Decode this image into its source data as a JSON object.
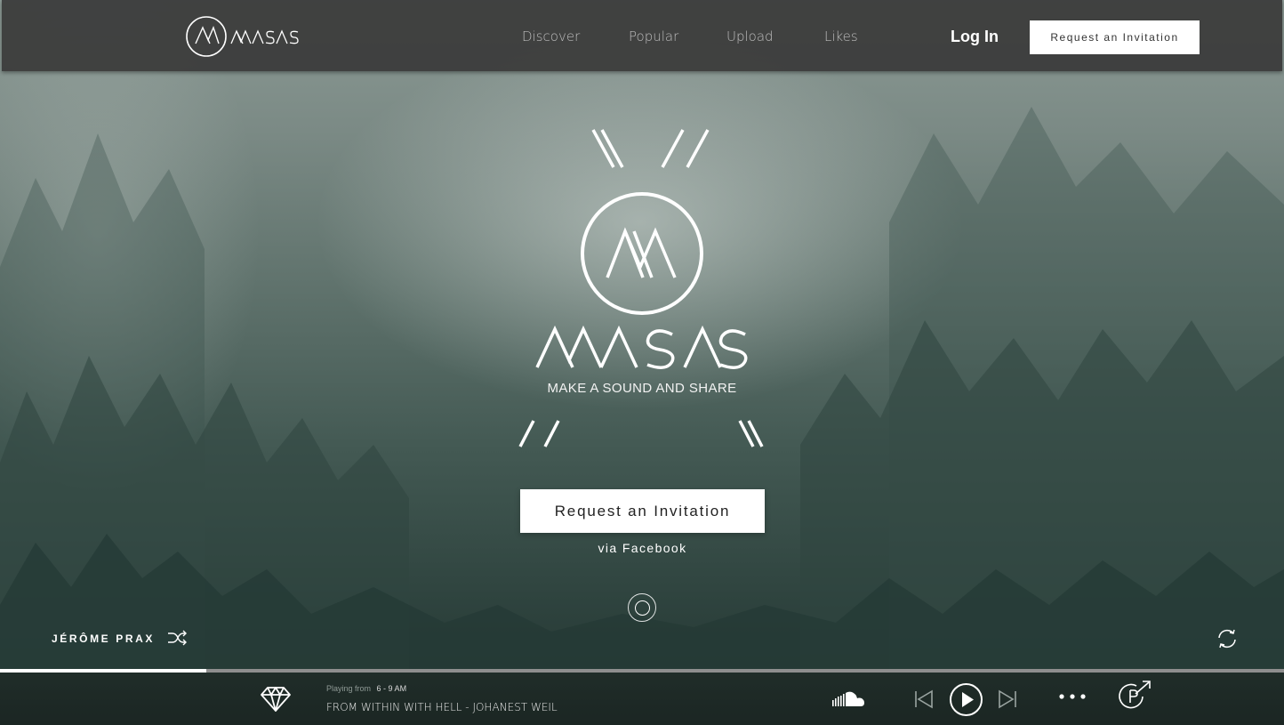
{
  "brand": {
    "name": "MASAS",
    "tagline": "MAKE A SOUND AND SHARE"
  },
  "nav": {
    "items": [
      "Discover",
      "Popular",
      "Upload",
      "Likes"
    ],
    "login_label": "Log In",
    "invite_label": "Request an Invitation"
  },
  "hero": {
    "invite_label": "Request an Invitation",
    "via_label": "via Facebook"
  },
  "now_playing": {
    "artist": "JÉRÔME PRAX",
    "playing_from_label": "Playing from",
    "time_slot": "6 - 9 AM",
    "track": "FROM WITHIN WITH HELL -  JOHANEST WEIL",
    "progress": 0.161
  },
  "icons": [
    "masas-logo",
    "shuffle-icon",
    "refresh-icon",
    "diamond-icon",
    "soundcloud-icon",
    "previous-icon",
    "play-icon",
    "next-icon",
    "more-icon",
    "share-icon",
    "scroll-indicator-icon"
  ],
  "colors": {
    "topbar": "#3a3a3a",
    "player": "#1e2b28",
    "accent": "#ffffff"
  }
}
